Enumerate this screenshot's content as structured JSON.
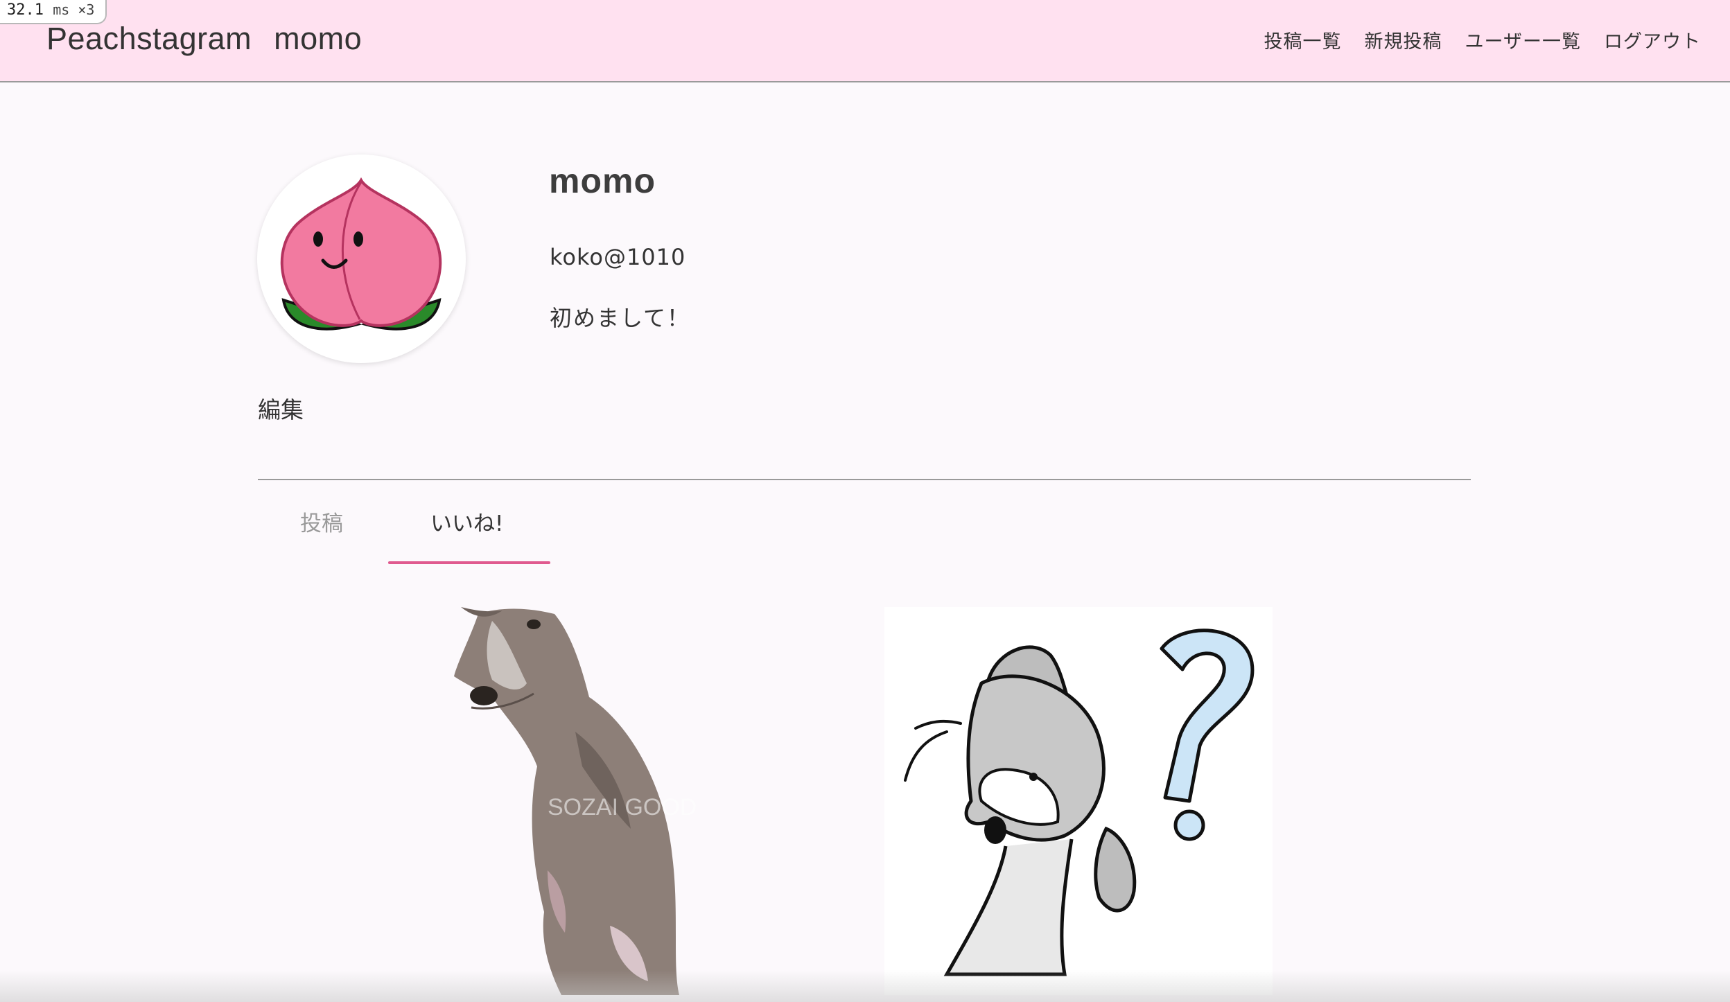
{
  "perf": {
    "value": "32.1",
    "unit": "ms ×3"
  },
  "header": {
    "brand": "Peachstagram",
    "username": "momo",
    "nav": [
      {
        "label": "投稿一覧"
      },
      {
        "label": "新規投稿"
      },
      {
        "label": "ユーザー一覧"
      },
      {
        "label": "ログアウト"
      }
    ]
  },
  "profile": {
    "avatar_icon": "peach-icon",
    "name": "momo",
    "handle": "koko@1010",
    "bio": "初めまして！",
    "edit_label": "編集"
  },
  "tabs": {
    "posts_label": "投稿",
    "likes_label": "いいね!",
    "active": "likes"
  },
  "liked_posts": [
    {
      "image": "sitting-dog-illustration",
      "watermark": "SOZAI GOOD"
    },
    {
      "image": "confused-dog-illustration"
    }
  ],
  "colors": {
    "header_bg": "#ffe1f0",
    "accent": "#e05a8f",
    "page_bg": "#fcf9fc"
  }
}
